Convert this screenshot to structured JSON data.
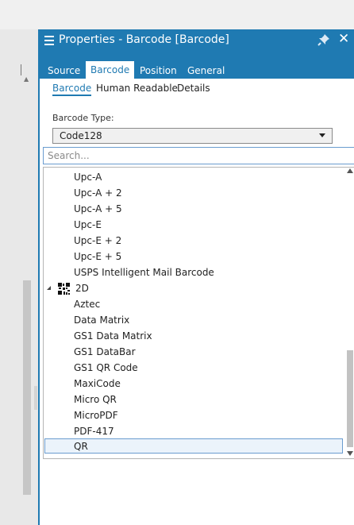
{
  "panel": {
    "title": "Properties - Barcode [Barcode]",
    "accent": "#1f7ab2"
  },
  "tabs": [
    {
      "label": "Source",
      "active": false
    },
    {
      "label": "Barcode",
      "active": true
    },
    {
      "label": "Position",
      "active": false
    },
    {
      "label": "General",
      "active": false
    }
  ],
  "subtabs": [
    {
      "label": "Barcode",
      "active": true
    },
    {
      "label": "Human Readable",
      "active": false
    },
    {
      "label": "Details",
      "active": false
    }
  ],
  "barcode_type": {
    "label": "Barcode Type:",
    "value": "Code128"
  },
  "search": {
    "placeholder": "Search..."
  },
  "list": {
    "items_1d": [
      "Upc-A",
      "Upc-A + 2",
      "Upc-A + 5",
      "Upc-E",
      "Upc-E + 2",
      "Upc-E + 5",
      "USPS Intelligent Mail Barcode"
    ],
    "group_2d": {
      "label": "2D",
      "icon": "qr-code-icon",
      "expanded": true
    },
    "items_2d": [
      "Aztec",
      "Data Matrix",
      "GS1 Data Matrix",
      "GS1 DataBar",
      "GS1 QR Code",
      "MaxiCode",
      "Micro QR",
      "MicroPDF",
      "PDF-417",
      "QR"
    ],
    "selected": "QR"
  }
}
